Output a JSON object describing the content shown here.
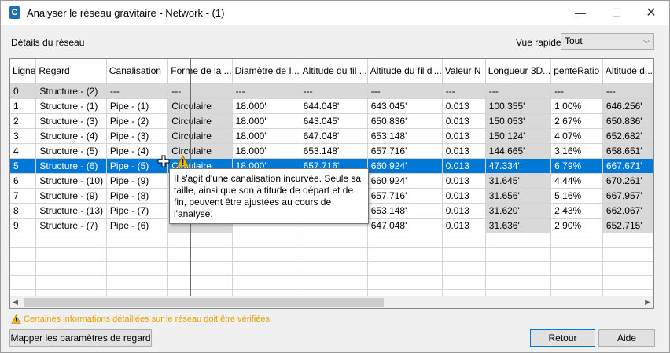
{
  "window": {
    "title": "Analyser le réseau gravitaire - Network - (1)",
    "app_icon_letter": "C",
    "minimize_glyph": "—",
    "maximize_glyph": "☐",
    "close_glyph": "✕"
  },
  "header": {
    "details_label": "Détails du réseau",
    "quick_view_label": "Vue rapide",
    "quick_view_value": "Tout"
  },
  "table": {
    "columns": [
      "Ligne",
      "Regard",
      "Canalisation",
      "Forme de la ...",
      "Diamètre de  I...",
      "Altitude du fil ...",
      "Altitude du fil d'...",
      "Valeur N",
      "Longueur 3D...",
      "penteRatio",
      "Altitude d..."
    ],
    "rows": [
      [
        "0",
        "Structure - (2)",
        "---",
        "---",
        "---",
        "---",
        "---",
        "---",
        "---",
        "---",
        "---"
      ],
      [
        "1",
        "Structure - (1)",
        "Pipe - (1)",
        "Circulaire",
        "18.000\"",
        "644.048'",
        "643.045'",
        "0.013",
        "100.355'",
        "1.00%",
        "646.256'"
      ],
      [
        "2",
        "Structure - (3)",
        "Pipe - (2)",
        "Circulaire",
        "18.000\"",
        "643.045'",
        "650.836'",
        "0.013",
        "150.053'",
        "2.67%",
        "650.836'"
      ],
      [
        "3",
        "Structure - (4)",
        "Pipe - (3)",
        "Circulaire",
        "18.000\"",
        "647.048'",
        "653.148'",
        "0.013",
        "150.124'",
        "4.07%",
        "652.682'"
      ],
      [
        "4",
        "Structure - (5)",
        "Pipe - (4)",
        "Circulaire",
        "18.000\"",
        "653.148'",
        "657.716'",
        "0.013",
        "144.665'",
        "3.16%",
        "658.651'"
      ],
      [
        "5",
        "Structure - (6)",
        "Pipe - (5)",
        "Circulaire",
        "18.000\"",
        "657.716'",
        "660.924'",
        "0.013",
        "47.334'",
        "6.79%",
        "667.671'"
      ],
      [
        "6",
        "Structure - (10)",
        "Pipe - (9)",
        "",
        "",
        "",
        "660.924'",
        "0.013",
        "31.645'",
        "4.44%",
        "670.261'"
      ],
      [
        "7",
        "Structure - (9)",
        "Pipe - (8)",
        "",
        "",
        "",
        "657.716'",
        "0.013",
        "31.656'",
        "5.16%",
        "667.957'"
      ],
      [
        "8",
        "Structure - (13)",
        "Pipe - (7)",
        "",
        "",
        "",
        "653.148'",
        "0.013",
        "31.620'",
        "2.43%",
        "662.067'"
      ],
      [
        "9",
        "Structure - (7)",
        "Pipe - (6)",
        "",
        "",
        "",
        "647.048'",
        "0.013",
        "31.636'",
        "2.90%",
        "652.715'"
      ]
    ],
    "selected_row": 5,
    "scroll_left_glyph": "◀",
    "scroll_right_glyph": "▶"
  },
  "tooltip": {
    "text": "Il s'agit d'une canalisation incurvée. Seule sa taille, ainsi que son altitude de départ et de fin, peuvent être ajustées au cours de l'analyse."
  },
  "footer": {
    "warning_text": "Certaines informations détaillées sur le réseau doit être vérifiées.",
    "map_button": "Mapper les paramètres de regard",
    "back_button": "Retour",
    "help_button": "Aide"
  },
  "icons": {
    "warning": "warning-triangle-icon",
    "position_marker": "plus-cursor-icon"
  },
  "colors": {
    "selection": "#0078d7",
    "readonly_cell": "#d9d9d9",
    "warning": "#e8a000"
  }
}
